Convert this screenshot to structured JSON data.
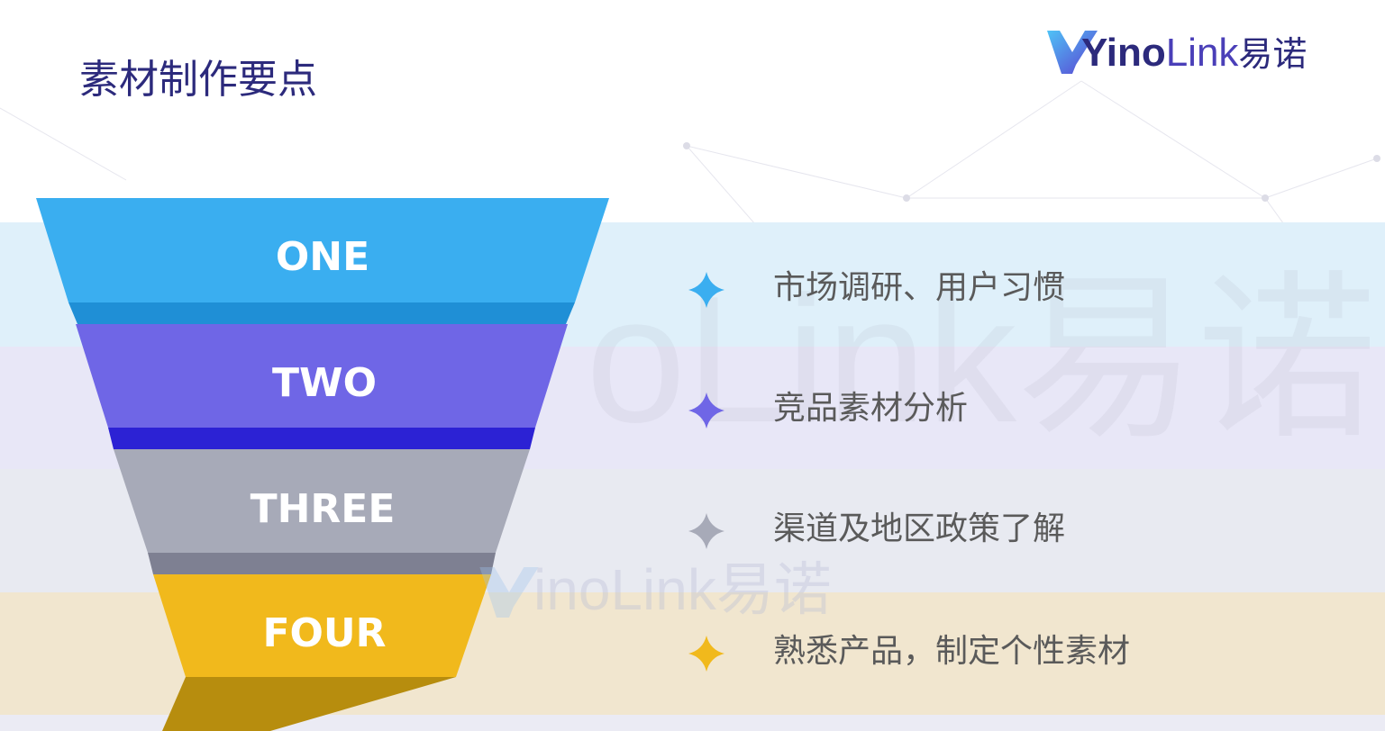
{
  "title": "素材制作要点",
  "logo": {
    "part1": "Yino",
    "part2": "Link",
    "part3": "易诺",
    "icon": "yinolink-logo"
  },
  "watermark": {
    "big": "oLink易诺",
    "small": "inoLink易诺"
  },
  "funnel": {
    "levels": [
      {
        "label": "ONE",
        "color": "#3aaef0",
        "fold": "#1f8fd6"
      },
      {
        "label": "TWO",
        "color": "#6f66e6",
        "fold": "#2c22d4"
      },
      {
        "label": "THREE",
        "color": "#a7aab8",
        "fold": "#7e8092"
      },
      {
        "label": "FOUR",
        "color": "#f1b91c",
        "fold": "#b78d0e"
      }
    ]
  },
  "items": [
    {
      "text": "市场调研、用户习惯",
      "icon": "four-point-star-icon",
      "color": "#3aaef0"
    },
    {
      "text": "竞品素材分析",
      "icon": "four-point-star-icon",
      "color": "#6f66e6"
    },
    {
      "text": "渠道及地区政策了解",
      "icon": "four-point-star-icon",
      "color": "#a7aab8"
    },
    {
      "text": "熟悉产品，制定个性素材",
      "icon": "four-point-star-icon",
      "color": "#f1b91c"
    }
  ]
}
